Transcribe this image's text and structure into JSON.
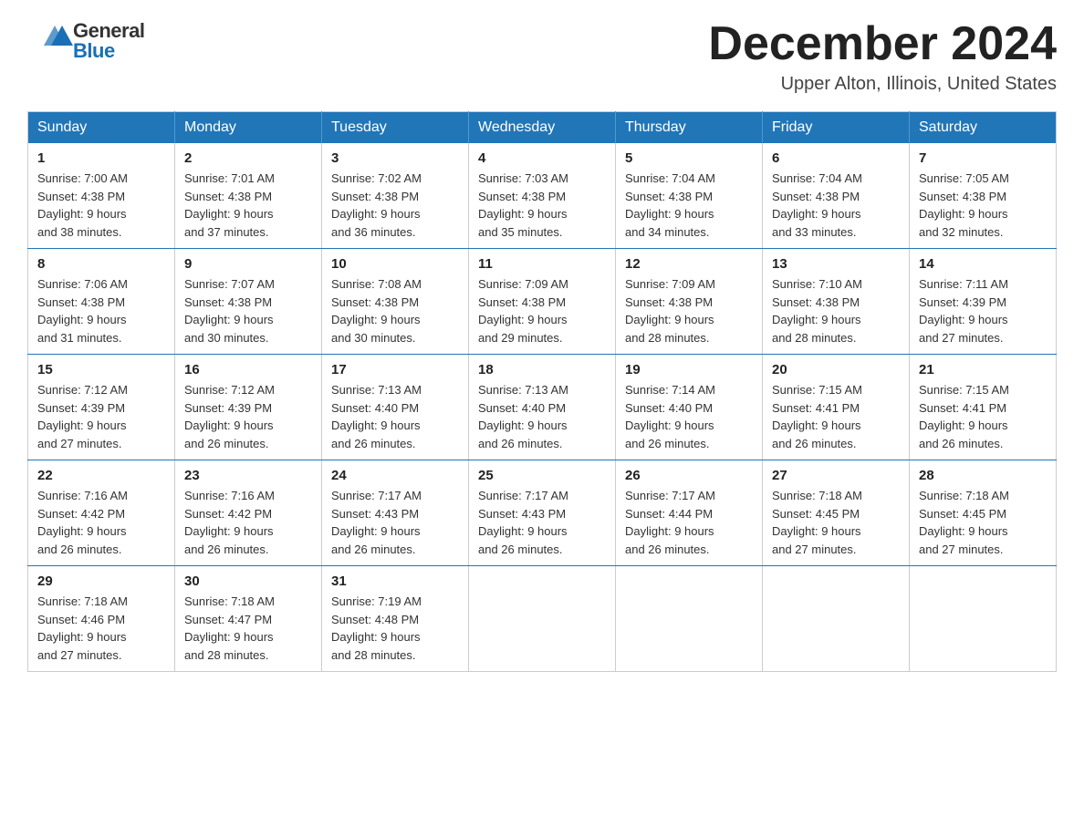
{
  "header": {
    "logo_general": "General",
    "logo_blue": "Blue",
    "month_title": "December 2024",
    "location": "Upper Alton, Illinois, United States"
  },
  "days_of_week": [
    "Sunday",
    "Monday",
    "Tuesday",
    "Wednesday",
    "Thursday",
    "Friday",
    "Saturday"
  ],
  "weeks": [
    [
      {
        "num": "1",
        "sunrise": "7:00 AM",
        "sunset": "4:38 PM",
        "daylight": "9 hours and 38 minutes."
      },
      {
        "num": "2",
        "sunrise": "7:01 AM",
        "sunset": "4:38 PM",
        "daylight": "9 hours and 37 minutes."
      },
      {
        "num": "3",
        "sunrise": "7:02 AM",
        "sunset": "4:38 PM",
        "daylight": "9 hours and 36 minutes."
      },
      {
        "num": "4",
        "sunrise": "7:03 AM",
        "sunset": "4:38 PM",
        "daylight": "9 hours and 35 minutes."
      },
      {
        "num": "5",
        "sunrise": "7:04 AM",
        "sunset": "4:38 PM",
        "daylight": "9 hours and 34 minutes."
      },
      {
        "num": "6",
        "sunrise": "7:04 AM",
        "sunset": "4:38 PM",
        "daylight": "9 hours and 33 minutes."
      },
      {
        "num": "7",
        "sunrise": "7:05 AM",
        "sunset": "4:38 PM",
        "daylight": "9 hours and 32 minutes."
      }
    ],
    [
      {
        "num": "8",
        "sunrise": "7:06 AM",
        "sunset": "4:38 PM",
        "daylight": "9 hours and 31 minutes."
      },
      {
        "num": "9",
        "sunrise": "7:07 AM",
        "sunset": "4:38 PM",
        "daylight": "9 hours and 30 minutes."
      },
      {
        "num": "10",
        "sunrise": "7:08 AM",
        "sunset": "4:38 PM",
        "daylight": "9 hours and 30 minutes."
      },
      {
        "num": "11",
        "sunrise": "7:09 AM",
        "sunset": "4:38 PM",
        "daylight": "9 hours and 29 minutes."
      },
      {
        "num": "12",
        "sunrise": "7:09 AM",
        "sunset": "4:38 PM",
        "daylight": "9 hours and 28 minutes."
      },
      {
        "num": "13",
        "sunrise": "7:10 AM",
        "sunset": "4:38 PM",
        "daylight": "9 hours and 28 minutes."
      },
      {
        "num": "14",
        "sunrise": "7:11 AM",
        "sunset": "4:39 PM",
        "daylight": "9 hours and 27 minutes."
      }
    ],
    [
      {
        "num": "15",
        "sunrise": "7:12 AM",
        "sunset": "4:39 PM",
        "daylight": "9 hours and 27 minutes."
      },
      {
        "num": "16",
        "sunrise": "7:12 AM",
        "sunset": "4:39 PM",
        "daylight": "9 hours and 26 minutes."
      },
      {
        "num": "17",
        "sunrise": "7:13 AM",
        "sunset": "4:40 PM",
        "daylight": "9 hours and 26 minutes."
      },
      {
        "num": "18",
        "sunrise": "7:13 AM",
        "sunset": "4:40 PM",
        "daylight": "9 hours and 26 minutes."
      },
      {
        "num": "19",
        "sunrise": "7:14 AM",
        "sunset": "4:40 PM",
        "daylight": "9 hours and 26 minutes."
      },
      {
        "num": "20",
        "sunrise": "7:15 AM",
        "sunset": "4:41 PM",
        "daylight": "9 hours and 26 minutes."
      },
      {
        "num": "21",
        "sunrise": "7:15 AM",
        "sunset": "4:41 PM",
        "daylight": "9 hours and 26 minutes."
      }
    ],
    [
      {
        "num": "22",
        "sunrise": "7:16 AM",
        "sunset": "4:42 PM",
        "daylight": "9 hours and 26 minutes."
      },
      {
        "num": "23",
        "sunrise": "7:16 AM",
        "sunset": "4:42 PM",
        "daylight": "9 hours and 26 minutes."
      },
      {
        "num": "24",
        "sunrise": "7:17 AM",
        "sunset": "4:43 PM",
        "daylight": "9 hours and 26 minutes."
      },
      {
        "num": "25",
        "sunrise": "7:17 AM",
        "sunset": "4:43 PM",
        "daylight": "9 hours and 26 minutes."
      },
      {
        "num": "26",
        "sunrise": "7:17 AM",
        "sunset": "4:44 PM",
        "daylight": "9 hours and 26 minutes."
      },
      {
        "num": "27",
        "sunrise": "7:18 AM",
        "sunset": "4:45 PM",
        "daylight": "9 hours and 27 minutes."
      },
      {
        "num": "28",
        "sunrise": "7:18 AM",
        "sunset": "4:45 PM",
        "daylight": "9 hours and 27 minutes."
      }
    ],
    [
      {
        "num": "29",
        "sunrise": "7:18 AM",
        "sunset": "4:46 PM",
        "daylight": "9 hours and 27 minutes."
      },
      {
        "num": "30",
        "sunrise": "7:18 AM",
        "sunset": "4:47 PM",
        "daylight": "9 hours and 28 minutes."
      },
      {
        "num": "31",
        "sunrise": "7:19 AM",
        "sunset": "4:48 PM",
        "daylight": "9 hours and 28 minutes."
      },
      null,
      null,
      null,
      null
    ]
  ],
  "labels": {
    "sunrise": "Sunrise:",
    "sunset": "Sunset:",
    "daylight": "Daylight:"
  }
}
